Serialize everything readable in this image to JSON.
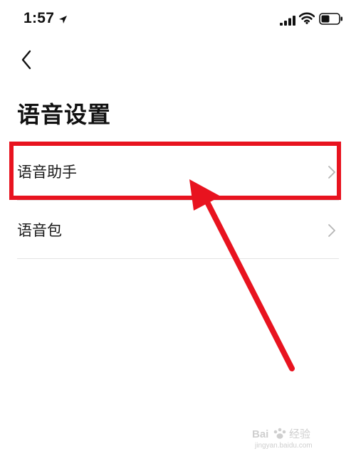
{
  "status_bar": {
    "time": "1:57",
    "icons": [
      "location-arrow-icon",
      "cellular-signal-icon",
      "wifi-icon",
      "battery-icon"
    ]
  },
  "navigation": {
    "back_icon": "chevron-left-icon"
  },
  "page": {
    "title": "语音设置"
  },
  "settings": {
    "items": [
      {
        "label": "语音助手",
        "icon": "chevron-right-icon",
        "highlighted": true
      },
      {
        "label": "语音包",
        "icon": "chevron-right-icon",
        "highlighted": false
      }
    ]
  },
  "annotation": {
    "highlight_color": "#e8131f",
    "arrow_color": "#e8131f"
  },
  "watermark": {
    "brand": "Baidu 经验",
    "url": "jingyan.baidu.com"
  },
  "colors": {
    "background": "#ffffff",
    "divider": "#e3e3e3",
    "chevron": "#b5b5b5"
  }
}
